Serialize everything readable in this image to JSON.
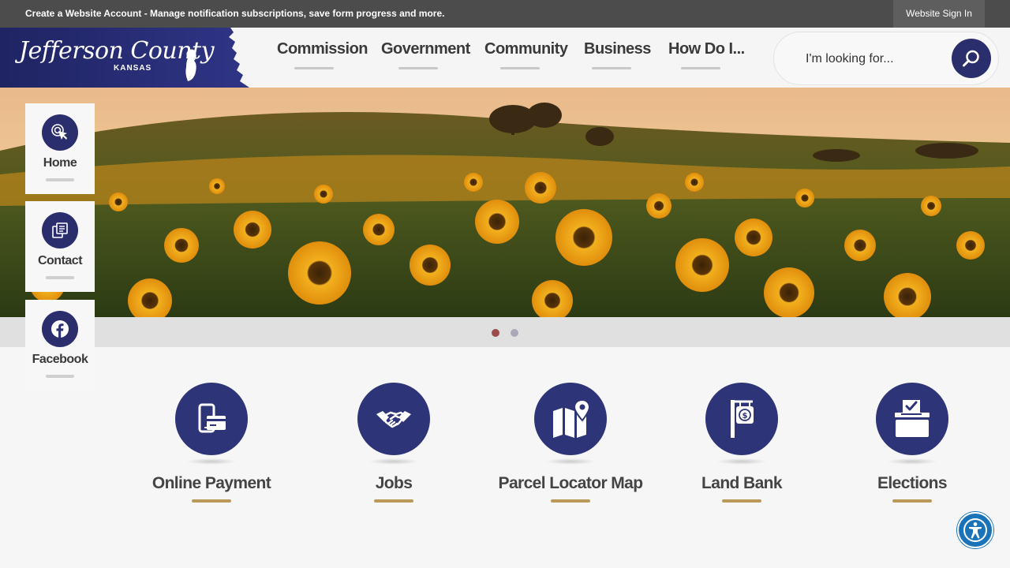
{
  "topbar": {
    "account_link": "Create a Website Account - Manage notification subscriptions, save form progress and more.",
    "signin": "Website Sign In"
  },
  "logo": {
    "name": "Jefferson County",
    "state": "KANSAS"
  },
  "nav": {
    "items": [
      {
        "label": "Commission"
      },
      {
        "label": "Government"
      },
      {
        "label": "Community"
      },
      {
        "label": "Business"
      },
      {
        "label": "How Do I..."
      }
    ]
  },
  "search": {
    "placeholder": "I'm looking for...",
    "icon": "search-icon"
  },
  "slider": {
    "dots": 2,
    "active_index": 0,
    "active_color": "#9c4a4a",
    "inactive_color": "#a9a9b9"
  },
  "side": {
    "items": [
      {
        "label": "Home",
        "icon": "touch-icon"
      },
      {
        "label": "Contact",
        "icon": "contact-icon"
      },
      {
        "label": "Facebook",
        "icon": "facebook-icon"
      }
    ]
  },
  "quick": {
    "items": [
      {
        "label": "Online Payment",
        "icon": "payment-icon"
      },
      {
        "label": "Jobs",
        "icon": "handshake-icon"
      },
      {
        "label": "Parcel Locator Map",
        "icon": "map-icon"
      },
      {
        "label": "Land Bank",
        "icon": "property-sign-icon"
      },
      {
        "label": "Elections",
        "icon": "ballot-box-icon"
      }
    ]
  },
  "colors": {
    "brand_navy": "#2b2e6d",
    "accent_gold": "#b99a5b",
    "topbar": "#4c4c4c",
    "accessibility": "#1a73b8"
  }
}
